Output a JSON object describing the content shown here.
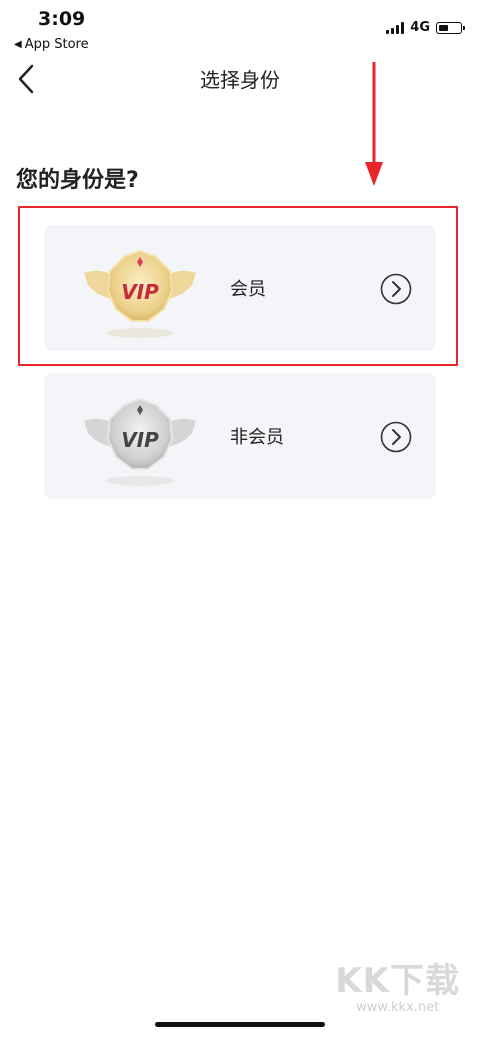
{
  "status_bar": {
    "time": "3:09",
    "back_app": "App Store",
    "network": "4G",
    "battery_level": 0.45
  },
  "nav": {
    "title": "选择身份"
  },
  "question": "您的身份是?",
  "options": [
    {
      "label": "会员",
      "badge_text": "VIP",
      "badge_style": "gold",
      "selected_highlight": true
    },
    {
      "label": "非会员",
      "badge_text": "VIP",
      "badge_style": "silver",
      "selected_highlight": false
    }
  ],
  "icons": {
    "back": "chevron-left-icon",
    "option_arrow": "chevron-right-circle-icon",
    "badge": "vip-badge-icon"
  },
  "colors": {
    "highlight": "#e8262a",
    "card_bg": "#f4f5f9",
    "gold": "#e8c46a",
    "silver": "#bdbdbd",
    "vip_red": "#c8283c"
  },
  "watermark": {
    "logo": "KK下载",
    "url": "www.kkx.net"
  }
}
